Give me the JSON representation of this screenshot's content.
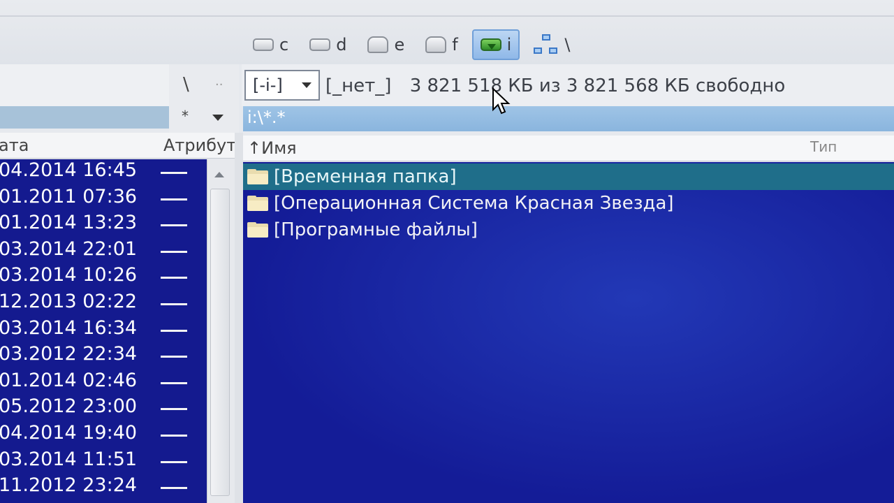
{
  "drives": [
    {
      "label": "c",
      "icon": "hard-drive-icon",
      "active": false
    },
    {
      "label": "d",
      "icon": "hard-drive-icon",
      "active": false
    },
    {
      "label": "e",
      "icon": "removable-drive-icon",
      "active": false
    },
    {
      "label": "f",
      "icon": "removable-drive-icon",
      "active": false
    },
    {
      "label": "i",
      "icon": "usb-drive-icon",
      "active": true
    },
    {
      "label": "\\",
      "icon": "network-icon",
      "active": false
    }
  ],
  "controls": {
    "root_label": "\\",
    "up_label": "..",
    "star_label": "*"
  },
  "left_panel": {
    "col_date": "ата",
    "col_attr": "Атрибут",
    "attr_dash": "—",
    "rows": [
      "04.2014 16:45",
      "01.2011 07:36",
      "01.2014 13:23",
      "03.2014 22:01",
      "03.2014 10:26",
      "12.2013 02:22",
      "03.2014 16:34",
      "03.2012 22:34",
      "01.2014 02:46",
      "05.2012 23:00",
      "04.2014 19:40",
      "03.2014 11:51",
      "11.2012 23:24"
    ]
  },
  "right_panel": {
    "drive_select": "[-i-]",
    "volume_label": "[_нет_]",
    "free_space_text": "3 821 518 КБ из 3 821 568 КБ свободно",
    "path": "i:\\*.*",
    "col_name": "↑Имя",
    "col_type": "Тип",
    "items": [
      {
        "name": "[Временная папка]",
        "selected": true
      },
      {
        "name": "[Операционная Система Красная Звезда]",
        "selected": false
      },
      {
        "name": "[Програмные файлы]",
        "selected": false
      }
    ]
  },
  "colors": {
    "panel_bg": "#141a8f",
    "selection": "#1f6e8a",
    "path_bar": "#9fc4e6"
  }
}
